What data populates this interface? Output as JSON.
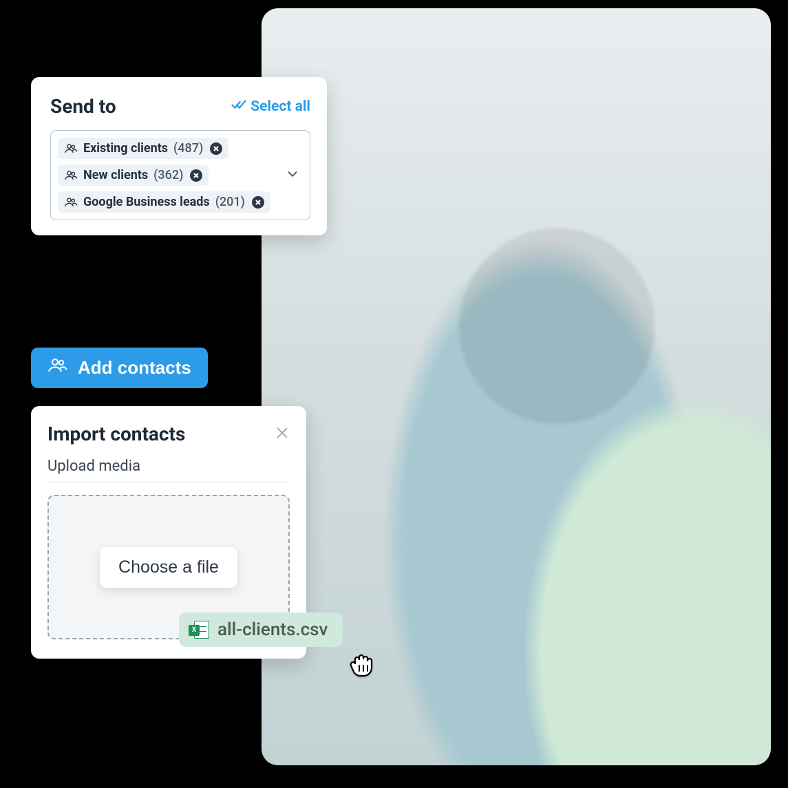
{
  "photo_alt": "Dentist in blue scrubs consulting patient",
  "send_to": {
    "title": "Send to",
    "select_all_label": "Select all",
    "chips": [
      {
        "label": "Existing clients",
        "count": "(487)"
      },
      {
        "label": "New clients",
        "count": "(362)"
      },
      {
        "label": "Google Business leads",
        "count": "(201)"
      }
    ]
  },
  "add_contacts_label": "Add contacts",
  "import": {
    "title": "Import contacts",
    "upload_label": "Upload media",
    "choose_label": "Choose a file"
  },
  "file": {
    "name": "all-clients.csv",
    "badge": "X"
  }
}
